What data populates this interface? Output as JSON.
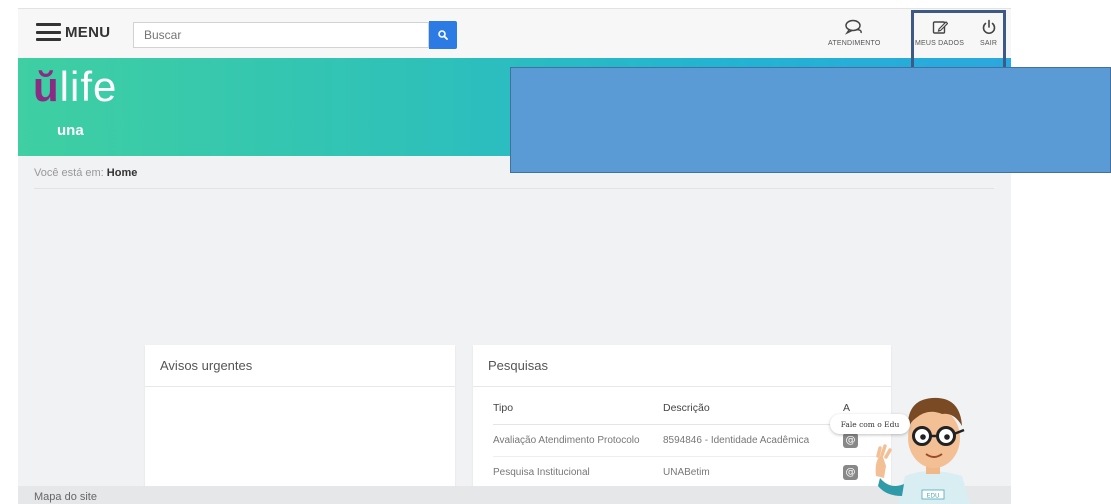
{
  "header": {
    "menu_label": "MENU",
    "search_placeholder": "Buscar",
    "atendimento_label": "ATENDIMENTO",
    "meus_dados_label": "MEUS DADOS",
    "sair_label": "SAIR"
  },
  "banner": {
    "logo_u": "ŭ",
    "logo_text": "life",
    "logo_sub": "una"
  },
  "breadcrumb": {
    "prefix": "Você está em:",
    "current": "Home"
  },
  "avisos": {
    "title": "Avisos urgentes"
  },
  "pesquisas": {
    "title": "Pesquisas",
    "columns": [
      "Tipo",
      "Descrição",
      "A"
    ],
    "rows": [
      {
        "tipo": "Avaliação Atendimento Protocolo",
        "descricao": "8594846 - Identidade Acadêmica"
      },
      {
        "tipo": "Pesquisa Institucional",
        "descricao": "UNABetim"
      }
    ]
  },
  "mascot": {
    "bubble": "Fale com o Edu",
    "shirt": "EDU"
  },
  "footer": {
    "sitemap": "Mapa do site"
  },
  "colors": {
    "accent": "#2c7be5",
    "brand_purple": "#8a2c84",
    "banner_start": "#3fcfa2",
    "banner_end": "#2aa8df",
    "overlay_blue": "#5b9bd5"
  }
}
